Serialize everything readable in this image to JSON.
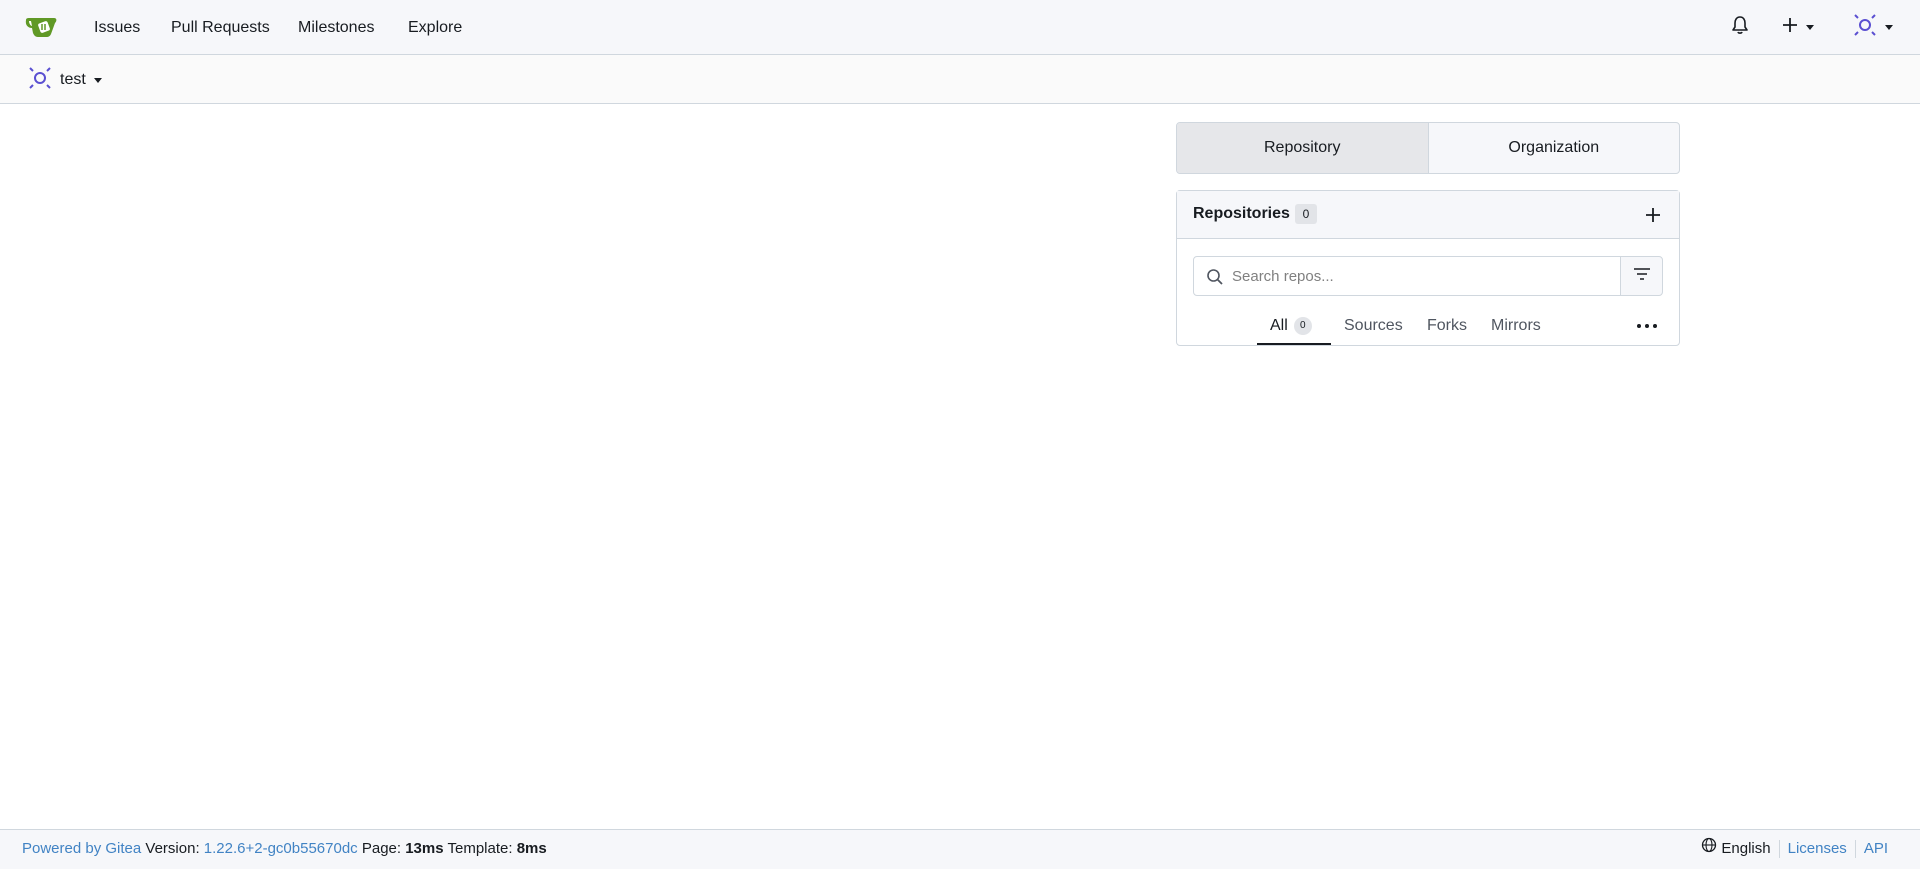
{
  "nav": {
    "items": [
      {
        "label": "Issues"
      },
      {
        "label": "Pull Requests"
      },
      {
        "label": "Milestones"
      },
      {
        "label": "Explore"
      }
    ],
    "icons": [
      "gitea-logo-icon",
      "bell-icon",
      "plus-icon",
      "avatar"
    ]
  },
  "context": {
    "user": "test"
  },
  "dashboard": {
    "tabs": [
      {
        "label": "Repository",
        "active": true
      },
      {
        "label": "Organization",
        "active": false
      }
    ],
    "repos": {
      "title": "Repositories",
      "count": "0",
      "search_placeholder": "Search repos...",
      "filters": [
        {
          "label": "All",
          "count": "0",
          "active": true
        },
        {
          "label": "Sources"
        },
        {
          "label": "Forks"
        },
        {
          "label": "Mirrors"
        }
      ]
    }
  },
  "footer": {
    "powered_by": "Powered by Gitea",
    "version_label": "Version:",
    "version": "1.22.6+2-gc0b55670dc",
    "page_label": "Page:",
    "page_time": "13ms",
    "template_label": "Template:",
    "template_time": "8ms",
    "language": "English",
    "licenses": "Licenses",
    "api": "API"
  },
  "colors": {
    "accent": "#4183c4",
    "logo_green": "#609926",
    "avatar_purple": "#5a4fd1"
  }
}
